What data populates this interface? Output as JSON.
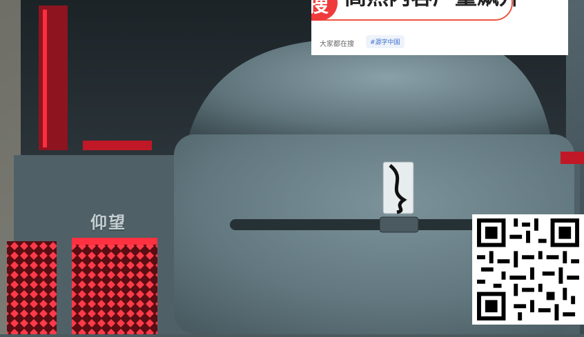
{
  "photo": {
    "brand_text": "仰望"
  },
  "search_widget": {
    "badge": "热搜",
    "query": "高热内容产量飙升",
    "trend_label": "大家都在搜",
    "trend_tag": "#源字中国"
  },
  "qr": {
    "icon": "qr-code-icon"
  }
}
